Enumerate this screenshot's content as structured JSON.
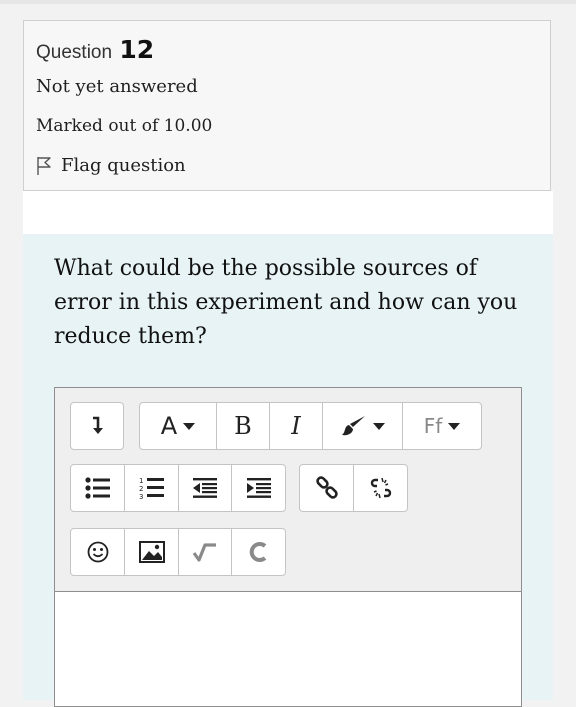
{
  "question": {
    "label": "Question",
    "number": "12",
    "state": "Not yet answered",
    "grade": "Marked out of 10.00",
    "flag_label": "Flag question",
    "text": "What could be the possible sources of error in this experiment and how can you reduce them?"
  },
  "toolbar": {
    "font_style_label": "A",
    "bold_label": "B",
    "italic_label": "I",
    "font_family_label": "Ff"
  },
  "editor": {
    "value": ""
  },
  "colors": {
    "question_background": "#e7f3f5",
    "info_background": "#f7f7f7",
    "toolbar_background": "#efefef"
  },
  "icons": [
    "flag-icon",
    "collapse-icon",
    "paint-icon",
    "unordered-list-icon",
    "ordered-list-icon",
    "outdent-icon",
    "indent-icon",
    "link-icon",
    "unlink-icon",
    "emoji-icon",
    "image-icon",
    "equation-icon",
    "recordrtc-icon"
  ]
}
